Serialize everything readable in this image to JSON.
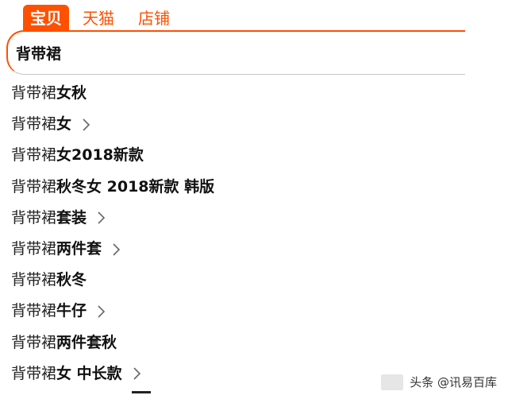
{
  "tabs": [
    {
      "label": "宝贝",
      "active": true
    },
    {
      "label": "天猫",
      "active": false
    },
    {
      "label": "店铺",
      "active": false
    }
  ],
  "search": {
    "value": "背带裙"
  },
  "suggestions": [
    {
      "prefix": "背带裙",
      "rest": "女秋",
      "arrow": false
    },
    {
      "prefix": "背带裙",
      "rest": "女",
      "arrow": true
    },
    {
      "prefix": "背带裙",
      "rest": "女2018新款",
      "arrow": false
    },
    {
      "prefix": "背带裙",
      "rest": "秋冬女 2018新款 韩版",
      "arrow": false
    },
    {
      "prefix": "背带裙",
      "rest": "套装",
      "arrow": true
    },
    {
      "prefix": "背带裙",
      "rest": "两件套",
      "arrow": true
    },
    {
      "prefix": "背带裙",
      "rest": "秋冬",
      "arrow": false
    },
    {
      "prefix": "背带裙",
      "rest": "牛仔",
      "arrow": true
    },
    {
      "prefix": "背带裙",
      "rest": "两件套秋",
      "arrow": false
    },
    {
      "prefix": "背带裙",
      "rest": "女 中长款",
      "arrow": true
    }
  ],
  "watermark": {
    "text": "头条 @讯易百库"
  },
  "colors": {
    "accent": "#ff5000",
    "divider": "#c8c8c8"
  },
  "icons": {
    "suggestion_arrow": "chevron-right-icon"
  }
}
